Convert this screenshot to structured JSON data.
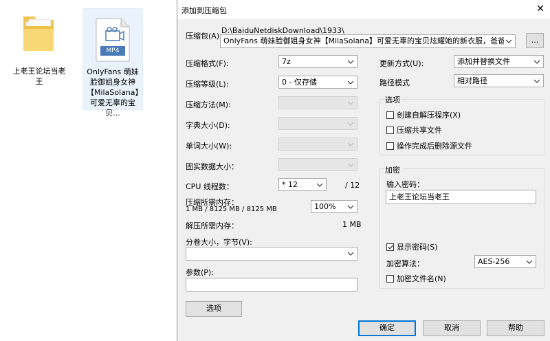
{
  "desktop": {
    "folder_label": "上老王论坛当老王",
    "file_label": "OnlyFans 萌妹脸御姐身女神【MilaSolana】可爱无辜的宝贝...",
    "file_badge": "MP4"
  },
  "dialog": {
    "title": "添加到压缩包",
    "archive_label": "压缩包(A):",
    "archive_path": "D:\\BaiduNetdiskDownload\\1933\\",
    "archive_name": "OnlyFans 萌妹脸御姐身女神【MilaSolana】可爱无辜的宝贝炫耀她的新衣服，爸爸用你的精",
    "browse_label": "...",
    "format_label": "压缩格式(F):",
    "format_value": "7z",
    "level_label": "压缩等级(L):",
    "level_value": "0 - 仅存储",
    "method_label": "压缩方法(M):",
    "dict_label": "字典大小(D):",
    "word_label": "单词大小(W):",
    "solid_label": "固实数据大小：",
    "cpu_label": "CPU 线程数：",
    "cpu_value": "* 12",
    "cpu_total": "/ 12",
    "mem_comp_label": "压缩所需内存：",
    "mem_comp_detail": "1 MB / 8125 MB / 8125 MB",
    "mem_percent": "100%",
    "mem_decomp_label": "解压所需内存：",
    "mem_decomp_value": "1 MB",
    "split_label": "分卷大小，字节(V):",
    "split_value": "",
    "params_label": "参数(P):",
    "params_value": "",
    "options_button": "选项",
    "update_label": "更新方式(U):",
    "update_value": "添加并替换文件",
    "path_label": "路径模式",
    "path_value": "相对路径",
    "options_group": "选项",
    "opt_sfx": "创建自解压程序(X)",
    "opt_shared": "压缩共享文件",
    "opt_delete": "操作完成后删除源文件",
    "encrypt_group": "加密",
    "password_label": "输入密码：",
    "password_value": "上老王论坛当老王",
    "show_password": "显示密码(S)",
    "enc_method_label": "加密算法：",
    "enc_method_value": "AES-256",
    "enc_filenames": "加密文件名(N)",
    "ok": "确定",
    "cancel": "取消",
    "help": "帮助"
  }
}
